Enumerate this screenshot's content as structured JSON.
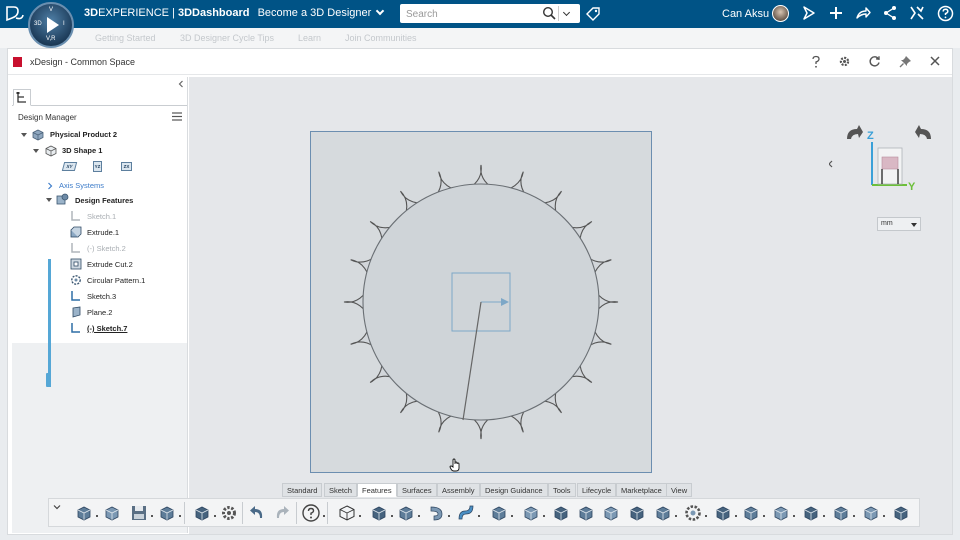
{
  "topbar": {
    "brand_prefix": "3D",
    "brand_experience": "EXPERIENCE",
    "brand_sep": " | ",
    "brand_dashboard": "3DDashboard",
    "dashboard_name": "Become a 3D Designer",
    "search_placeholder": "Search",
    "user_name": "Can Aksu",
    "compass": {
      "center": "3D",
      "north": "V",
      "east": "I",
      "south": "V,R"
    }
  },
  "dashboard_tabs": [
    "Getting Started",
    "3D Designer Cycle Tips",
    "Learn",
    "Join Communities"
  ],
  "app": {
    "title": "xDesign - Common Space"
  },
  "left_panel": {
    "title": "Design Manager",
    "tree": [
      {
        "label": "Physical Product 2",
        "style": "bold"
      },
      {
        "label": "3D Shape 1",
        "style": "bold"
      },
      {
        "label": "Axis Systems",
        "style": "blue"
      },
      {
        "label": "Design Features",
        "style": "bold"
      },
      {
        "label": "Sketch.1",
        "style": "dim"
      },
      {
        "label": "Extrude.1",
        "style": "normal"
      },
      {
        "label": "(-)  Sketch.2",
        "style": "dim"
      },
      {
        "label": "Extrude Cut.2",
        "style": "normal"
      },
      {
        "label": "Circular Pattern.1",
        "style": "normal"
      },
      {
        "label": "Sketch.3",
        "style": "normal"
      },
      {
        "label": "Plane.2",
        "style": "normal"
      },
      {
        "label": "(-)  Sketch.7",
        "style": "current"
      }
    ],
    "plane_icons": [
      "XY",
      "YZ",
      "ZX"
    ]
  },
  "viewport": {
    "unit": "mm",
    "triad": {
      "z_label": "Z",
      "y_label": "Y"
    }
  },
  "action_tabs": [
    "Standard",
    "Sketch",
    "Features",
    "Surfaces",
    "Assembly",
    "Design Guidance",
    "Tools",
    "Lifecycle",
    "Marketplace",
    "View"
  ],
  "active_action_tab": "Features",
  "colors": {
    "topbar": "#005386",
    "accent": "#55a7d6",
    "sheet_border": "#6c8eb0",
    "z_axis": "#3aa0d8",
    "y_axis": "#6cbf3a"
  }
}
